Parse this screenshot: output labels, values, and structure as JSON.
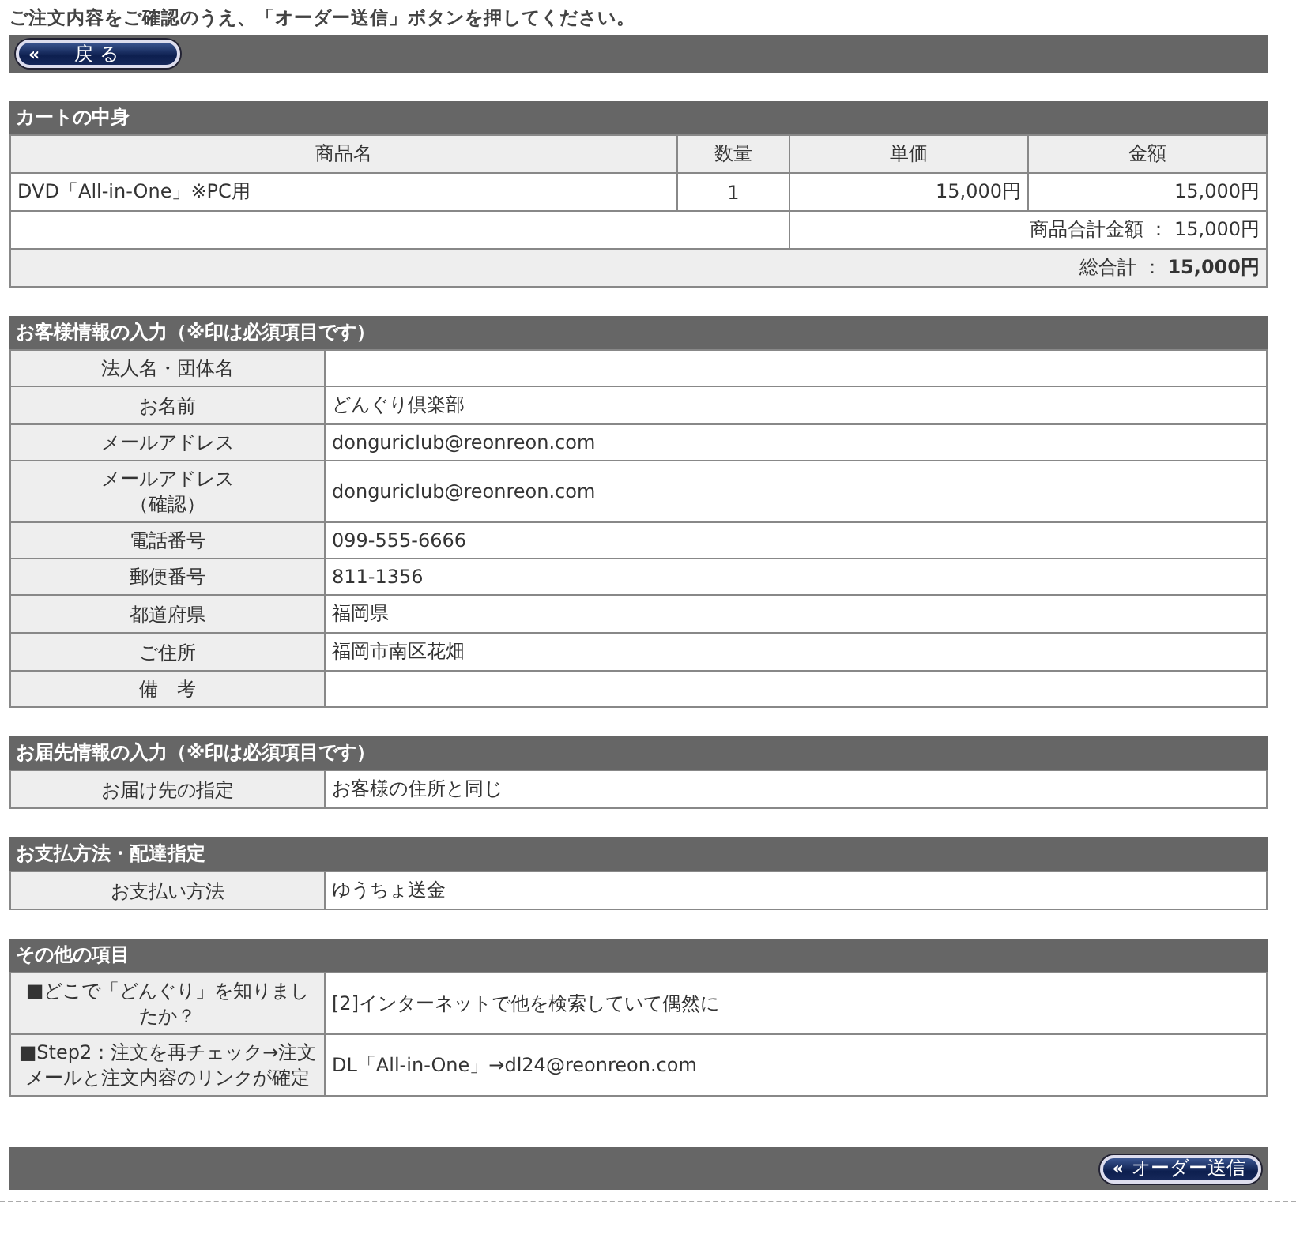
{
  "instruction": "ご注文内容をご確認のうえ、「オーダー送信」ボタンを押してください。",
  "back_button": {
    "icon": "«",
    "label": "戻 る"
  },
  "cart": {
    "title": "カートの中身",
    "columns": [
      "商品名",
      "数量",
      "単価",
      "金額"
    ],
    "rows": [
      [
        "DVD「All-in-One」※PC用",
        "1",
        "15,000円",
        "15,000円"
      ]
    ],
    "subtotal": "商品合計金額 ： 15,000円",
    "total": "総合計 ： **15,000円**"
  },
  "sections": [
    {
      "title": "お客様情報の入力（※印は必須項目です）",
      "rows": [
        {
          "label": "法人名・団体名"
        },
        {
          "label": "お名前",
          "value": "どんぐり倶楽部"
        },
        {
          "label": "メールアドレス",
          "value": "donguriclub@reonreon.com"
        },
        {
          "label": [
            "メールアドレス",
            "（確認）"
          ],
          "value": "donguriclub@reonreon.com"
        },
        {
          "label": "電話番号",
          "value": "099-555-6666"
        },
        {
          "label": "郵便番号",
          "value": "811-1356"
        },
        {
          "label": "都道府県",
          "value": "福岡県"
        },
        {
          "label": "ご住所",
          "value": "福岡市南区花畑"
        },
        {
          "label": "備　考"
        }
      ]
    },
    {
      "title": "お届先情報の入力（※印は必須項目です）",
      "rows": [
        {
          "label": "お届け先の指定",
          "value": "お客様の住所と同じ"
        }
      ]
    },
    {
      "title": "お支払方法・配達指定",
      "rows": [
        {
          "label": "お支払い方法",
          "value": "ゆうちょ送金"
        }
      ]
    },
    {
      "title": "その他の項目",
      "rows": [
        {
          "label": "■どこで「どんぐり」を知りましたか？",
          "value": "[2]インターネットで他を検索していて偶然に"
        },
        {
          "label": "■Step2：注文を再チェック→注文メールと注文内容のリンクが確定",
          "value": "DL「All-in-One」→dl24@reonreon.com"
        }
      ]
    }
  ],
  "submit_button": {
    "icon": "«",
    "label": "オーダー送信"
  }
}
